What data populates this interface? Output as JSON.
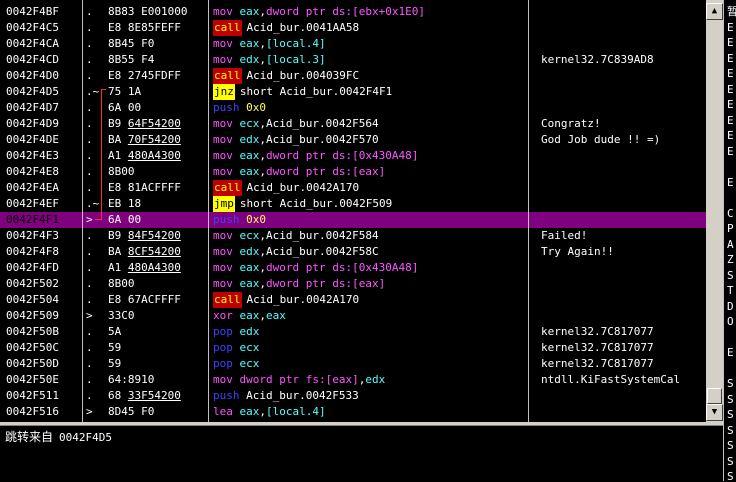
{
  "rows": [
    {
      "addr": "0042F4BF",
      "mark": ".",
      "hex": [
        {
          "t": "8B83 E001000"
        }
      ],
      "disasm": [
        {
          "t": "mov",
          "c": "t-mnem"
        },
        {
          "t": " eax",
          "c": "t-reg"
        },
        {
          "t": ",",
          "c": "t-text"
        },
        {
          "t": "dword ptr ds:[ebx+0x1E0]",
          "c": "t-mem"
        }
      ],
      "comment": ""
    },
    {
      "addr": "0042F4C5",
      "mark": ".",
      "hex": [
        {
          "t": "E8 8E85FEFF"
        }
      ],
      "disasm": [
        {
          "t": "call",
          "c": "hl-red op"
        },
        {
          "t": "Acid_bur.0041AA58",
          "c": "t-text"
        }
      ],
      "comment": ""
    },
    {
      "addr": "0042F4CA",
      "mark": ".",
      "hex": [
        {
          "t": "8B45 F0"
        }
      ],
      "disasm": [
        {
          "t": "mov",
          "c": "t-mnem"
        },
        {
          "t": " eax",
          "c": "t-reg"
        },
        {
          "t": ",",
          "c": "t-text"
        },
        {
          "t": "[local.4]",
          "c": "t-reg"
        }
      ],
      "comment": ""
    },
    {
      "addr": "0042F4CD",
      "mark": ".",
      "hex": [
        {
          "t": "8B55 F4"
        }
      ],
      "disasm": [
        {
          "t": "mov",
          "c": "t-mnem"
        },
        {
          "t": " edx",
          "c": "t-reg"
        },
        {
          "t": ",",
          "c": "t-text"
        },
        {
          "t": "[local.3]",
          "c": "t-reg"
        }
      ],
      "comment": "kernel32.7C839AD8"
    },
    {
      "addr": "0042F4D0",
      "mark": ".",
      "hex": [
        {
          "t": "E8 2745FDFF"
        }
      ],
      "disasm": [
        {
          "t": "call",
          "c": "hl-red op"
        },
        {
          "t": "Acid_bur.004039FC",
          "c": "t-text"
        }
      ],
      "comment": ""
    },
    {
      "addr": "0042F4D5",
      "mark": ".~",
      "hex": [
        {
          "t": "75 1A"
        }
      ],
      "disasm": [
        {
          "t": "jnz",
          "c": "hl-yellow op"
        },
        {
          "t": "short Acid_bur.0042F4F1",
          "c": "t-text"
        }
      ],
      "comment": ""
    },
    {
      "addr": "0042F4D7",
      "mark": ".",
      "hex": [
        {
          "t": "6A 00"
        }
      ],
      "disasm": [
        {
          "t": "push",
          "c": "t-pushc"
        },
        {
          "t": " 0x0",
          "c": "t-const"
        }
      ],
      "comment": ""
    },
    {
      "addr": "0042F4D9",
      "mark": ".",
      "hex": [
        {
          "t": "B9 "
        },
        {
          "t": "64F54200",
          "u": true
        }
      ],
      "disasm": [
        {
          "t": "mov",
          "c": "t-mnem"
        },
        {
          "t": " ecx",
          "c": "t-reg"
        },
        {
          "t": ",Acid_bur.0042F564",
          "c": "t-text"
        }
      ],
      "comment": "Congratz!"
    },
    {
      "addr": "0042F4DE",
      "mark": ".",
      "hex": [
        {
          "t": "BA "
        },
        {
          "t": "70F54200",
          "u": true
        }
      ],
      "disasm": [
        {
          "t": "mov",
          "c": "t-mnem"
        },
        {
          "t": " edx",
          "c": "t-reg"
        },
        {
          "t": ",Acid_bur.0042F570",
          "c": "t-text"
        }
      ],
      "comment": "God Job dude !! =)"
    },
    {
      "addr": "0042F4E3",
      "mark": ".",
      "hex": [
        {
          "t": "A1 "
        },
        {
          "t": "480A4300",
          "u": true
        }
      ],
      "disasm": [
        {
          "t": "mov",
          "c": "t-mnem"
        },
        {
          "t": " eax",
          "c": "t-reg"
        },
        {
          "t": ",",
          "c": "t-text"
        },
        {
          "t": "dword ptr ds:[0x430A48]",
          "c": "t-mem"
        }
      ],
      "comment": ""
    },
    {
      "addr": "0042F4E8",
      "mark": ".",
      "hex": [
        {
          "t": "8B00"
        }
      ],
      "disasm": [
        {
          "t": "mov",
          "c": "t-mnem"
        },
        {
          "t": " eax",
          "c": "t-reg"
        },
        {
          "t": ",",
          "c": "t-text"
        },
        {
          "t": "dword ptr ds:[eax]",
          "c": "t-mem"
        }
      ],
      "comment": ""
    },
    {
      "addr": "0042F4EA",
      "mark": ".",
      "hex": [
        {
          "t": "E8 81ACFFFF"
        }
      ],
      "disasm": [
        {
          "t": "call",
          "c": "hl-red op"
        },
        {
          "t": "Acid_bur.0042A170",
          "c": "t-text"
        }
      ],
      "comment": ""
    },
    {
      "addr": "0042F4EF",
      "mark": ".~",
      "hex": [
        {
          "t": "EB 18"
        }
      ],
      "disasm": [
        {
          "t": "jmp",
          "c": "hl-yellow op"
        },
        {
          "t": "short Acid_bur.0042F509",
          "c": "t-text"
        }
      ],
      "comment": ""
    },
    {
      "addr": "0042F4F1",
      "mark": ">",
      "hex": [
        {
          "t": "6A 00"
        }
      ],
      "disasm": [
        {
          "t": "push",
          "c": "t-pushc"
        },
        {
          "t": " 0x0",
          "c": "t-const"
        }
      ],
      "comment": "",
      "selected": true
    },
    {
      "addr": "0042F4F3",
      "mark": ".",
      "hex": [
        {
          "t": "B9 "
        },
        {
          "t": "84F54200",
          "u": true
        }
      ],
      "disasm": [
        {
          "t": "mov",
          "c": "t-mnem"
        },
        {
          "t": " ecx",
          "c": "t-reg"
        },
        {
          "t": ",Acid_bur.0042F584",
          "c": "t-text"
        }
      ],
      "comment": "Failed!"
    },
    {
      "addr": "0042F4F8",
      "mark": ".",
      "hex": [
        {
          "t": "BA "
        },
        {
          "t": "8CF54200",
          "u": true
        }
      ],
      "disasm": [
        {
          "t": "mov",
          "c": "t-mnem"
        },
        {
          "t": " edx",
          "c": "t-reg"
        },
        {
          "t": ",Acid_bur.0042F58C",
          "c": "t-text"
        }
      ],
      "comment": "Try Again!!"
    },
    {
      "addr": "0042F4FD",
      "mark": ".",
      "hex": [
        {
          "t": "A1 "
        },
        {
          "t": "480A4300",
          "u": true
        }
      ],
      "disasm": [
        {
          "t": "mov",
          "c": "t-mnem"
        },
        {
          "t": " eax",
          "c": "t-reg"
        },
        {
          "t": ",",
          "c": "t-text"
        },
        {
          "t": "dword ptr ds:[0x430A48]",
          "c": "t-mem"
        }
      ],
      "comment": ""
    },
    {
      "addr": "0042F502",
      "mark": ".",
      "hex": [
        {
          "t": "8B00"
        }
      ],
      "disasm": [
        {
          "t": "mov",
          "c": "t-mnem"
        },
        {
          "t": " eax",
          "c": "t-reg"
        },
        {
          "t": ",",
          "c": "t-text"
        },
        {
          "t": "dword ptr ds:[eax]",
          "c": "t-mem"
        }
      ],
      "comment": ""
    },
    {
      "addr": "0042F504",
      "mark": ".",
      "hex": [
        {
          "t": "E8 67ACFFFF"
        }
      ],
      "disasm": [
        {
          "t": "call",
          "c": "hl-red op"
        },
        {
          "t": "Acid_bur.0042A170",
          "c": "t-text"
        }
      ],
      "comment": ""
    },
    {
      "addr": "0042F509",
      "mark": ">",
      "hex": [
        {
          "t": "33C0"
        }
      ],
      "disasm": [
        {
          "t": "xor",
          "c": "t-mnem"
        },
        {
          "t": " eax",
          "c": "t-reg"
        },
        {
          "t": ",",
          "c": "t-text"
        },
        {
          "t": "eax",
          "c": "t-reg"
        }
      ],
      "comment": ""
    },
    {
      "addr": "0042F50B",
      "mark": ".",
      "hex": [
        {
          "t": "5A"
        }
      ],
      "disasm": [
        {
          "t": "pop",
          "c": "t-pushc"
        },
        {
          "t": " edx",
          "c": "t-reg"
        }
      ],
      "comment": "kernel32.7C817077"
    },
    {
      "addr": "0042F50C",
      "mark": ".",
      "hex": [
        {
          "t": "59"
        }
      ],
      "disasm": [
        {
          "t": "pop",
          "c": "t-pushc"
        },
        {
          "t": " ecx",
          "c": "t-reg"
        }
      ],
      "comment": "kernel32.7C817077"
    },
    {
      "addr": "0042F50D",
      "mark": ".",
      "hex": [
        {
          "t": "59"
        }
      ],
      "disasm": [
        {
          "t": "pop",
          "c": "t-pushc"
        },
        {
          "t": " ecx",
          "c": "t-reg"
        }
      ],
      "comment": "kernel32.7C817077"
    },
    {
      "addr": "0042F50E",
      "mark": ".",
      "hex": [
        {
          "t": "64:8910"
        }
      ],
      "disasm": [
        {
          "t": "mov",
          "c": "t-mnem"
        },
        {
          "t": " dword ptr fs:[eax]",
          "c": "t-mem"
        },
        {
          "t": ",",
          "c": "t-text"
        },
        {
          "t": "edx",
          "c": "t-reg"
        }
      ],
      "comment": "ntdll.KiFastSystemCal"
    },
    {
      "addr": "0042F511",
      "mark": ".",
      "hex": [
        {
          "t": "68 "
        },
        {
          "t": "33F54200",
          "u": true
        }
      ],
      "disasm": [
        {
          "t": "push",
          "c": "t-pushc"
        },
        {
          "t": " Acid_bur.0042F533",
          "c": "t-text"
        }
      ],
      "comment": ""
    },
    {
      "addr": "0042F516",
      "mark": ">",
      "hex": [
        {
          "t": "8D45 F0"
        }
      ],
      "disasm": [
        {
          "t": "lea",
          "c": "t-mnem"
        },
        {
          "t": " eax",
          "c": "t-reg"
        },
        {
          "t": ",",
          "c": "t-text"
        },
        {
          "t": "[local.4]",
          "c": "t-reg"
        }
      ],
      "comment": ""
    }
  ],
  "info": {
    "label": "跳转来自",
    "address": "0042F4D5"
  },
  "right_strip": [
    "暂",
    "E",
    "E",
    "E",
    "E",
    "E",
    "E",
    "E",
    "E",
    "E",
    "",
    "E",
    "",
    "C",
    "P",
    "A",
    "Z",
    "S",
    "T",
    "D",
    "O",
    "",
    "E",
    "",
    "S",
    "S",
    "S",
    "S",
    "S",
    "S",
    "S",
    "S"
  ],
  "scroll": {
    "up": "▲",
    "down": "▼"
  },
  "colors": {
    "selection": "#800080",
    "call_bg": "#c00000",
    "jump_bg": "#ffff00",
    "jump_arrow": "#ff2a2a"
  }
}
